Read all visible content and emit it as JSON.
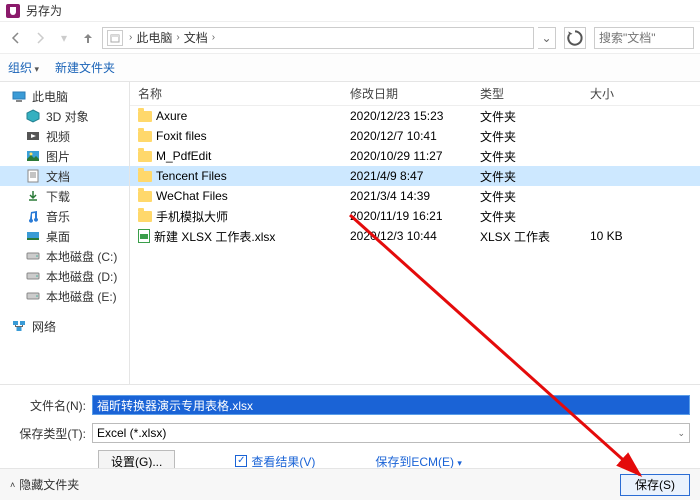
{
  "window": {
    "title": "另存为"
  },
  "breadcrumb": {
    "root": "此电脑",
    "folder": "文档",
    "search_placeholder": "搜索\"文档\""
  },
  "toolbar": {
    "organize": "组织",
    "new_folder": "新建文件夹"
  },
  "sidebar": {
    "groups": [
      {
        "label": "此电脑",
        "indent": false,
        "icon": "pc"
      },
      {
        "label": "3D 对象",
        "indent": true,
        "icon": "3d"
      },
      {
        "label": "视频",
        "indent": true,
        "icon": "video"
      },
      {
        "label": "图片",
        "indent": true,
        "icon": "pic"
      },
      {
        "label": "文档",
        "indent": true,
        "icon": "doc",
        "selected": true
      },
      {
        "label": "下载",
        "indent": true,
        "icon": "dl"
      },
      {
        "label": "音乐",
        "indent": true,
        "icon": "music"
      },
      {
        "label": "桌面",
        "indent": true,
        "icon": "desk"
      },
      {
        "label": "本地磁盘 (C:)",
        "indent": true,
        "icon": "disk"
      },
      {
        "label": "本地磁盘 (D:)",
        "indent": true,
        "icon": "disk"
      },
      {
        "label": "本地磁盘 (E:)",
        "indent": true,
        "icon": "disk"
      }
    ],
    "network": "网络"
  },
  "columns": {
    "name": "名称",
    "date": "修改日期",
    "type": "类型",
    "size": "大小"
  },
  "files": [
    {
      "name": "Axure",
      "date": "2020/12/23 15:23",
      "type": "文件夹",
      "size": "",
      "kind": "folder"
    },
    {
      "name": "Foxit files",
      "date": "2020/12/7 10:41",
      "type": "文件夹",
      "size": "",
      "kind": "folder"
    },
    {
      "name": "M_PdfEdit",
      "date": "2020/10/29 11:27",
      "type": "文件夹",
      "size": "",
      "kind": "folder"
    },
    {
      "name": "Tencent Files",
      "date": "2021/4/9 8:47",
      "type": "文件夹",
      "size": "",
      "kind": "folder",
      "selected": true
    },
    {
      "name": "WeChat Files",
      "date": "2021/3/4 14:39",
      "type": "文件夹",
      "size": "",
      "kind": "folder"
    },
    {
      "name": "手机模拟大师",
      "date": "2020/11/19 16:21",
      "type": "文件夹",
      "size": "",
      "kind": "folder"
    },
    {
      "name": "新建 XLSX 工作表.xlsx",
      "date": "2020/12/3 10:44",
      "type": "XLSX 工作表",
      "size": "10 KB",
      "kind": "xlsx"
    }
  ],
  "form": {
    "filename_label": "文件名(N):",
    "filename_value": "福昕转换器演示专用表格.xlsx",
    "filetype_label": "保存类型(T):",
    "filetype_value": "Excel (*.xlsx)",
    "settings_btn": "设置(G)...",
    "view_result": "查看结果(V)",
    "save_ecm": "保存到ECM(E)"
  },
  "footer": {
    "hide_folders": "隐藏文件夹",
    "save": "保存(S)"
  }
}
